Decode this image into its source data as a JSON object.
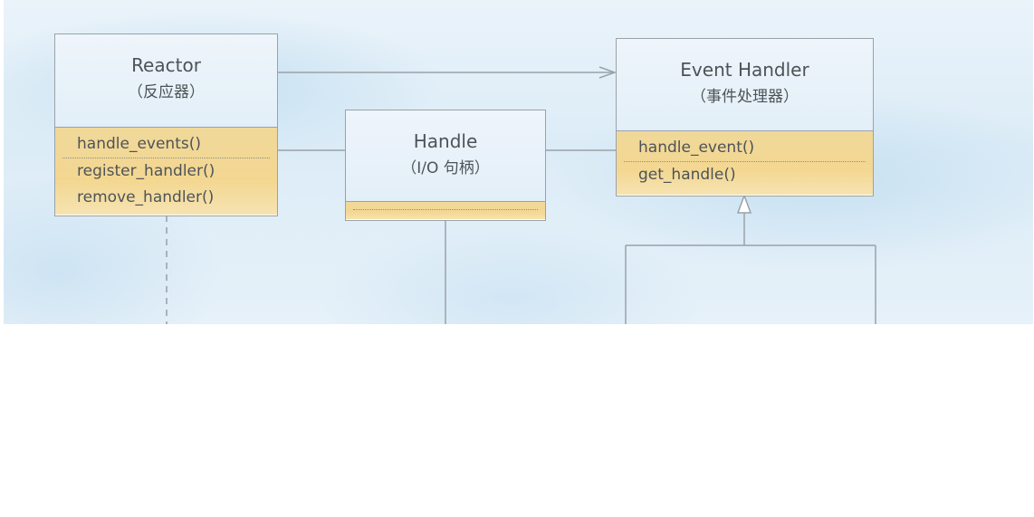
{
  "diagram": {
    "classes": {
      "reactor": {
        "name": "Reactor",
        "subtitle": "（反应器）",
        "methods_primary": [
          "handle_events()"
        ],
        "methods_secondary": [
          "register_handler()",
          "remove_handler()"
        ]
      },
      "handle": {
        "name": "Handle",
        "subtitle": "（I/O 句柄）"
      },
      "event_handler": {
        "name": "Event Handler",
        "subtitle": "（事件处理器）",
        "methods_primary": [
          "handle_event()"
        ],
        "methods_secondary": [
          "get_handle()"
        ]
      }
    },
    "relationships": [
      {
        "from": "reactor",
        "to": "event_handler",
        "kind": "association-arrow"
      },
      {
        "from": "reactor",
        "to": "handle",
        "kind": "association"
      },
      {
        "from": "handle",
        "to": "event_handler",
        "kind": "association"
      },
      {
        "from": "concrete handlers",
        "to": "event_handler",
        "kind": "generalization"
      },
      {
        "from": "reactor",
        "to": "below",
        "kind": "dependency-dashed"
      }
    ],
    "colors": {
      "line": "#9aa2a8",
      "header_fill": "#e6f1f9",
      "method_fill": "#f3d791"
    }
  }
}
